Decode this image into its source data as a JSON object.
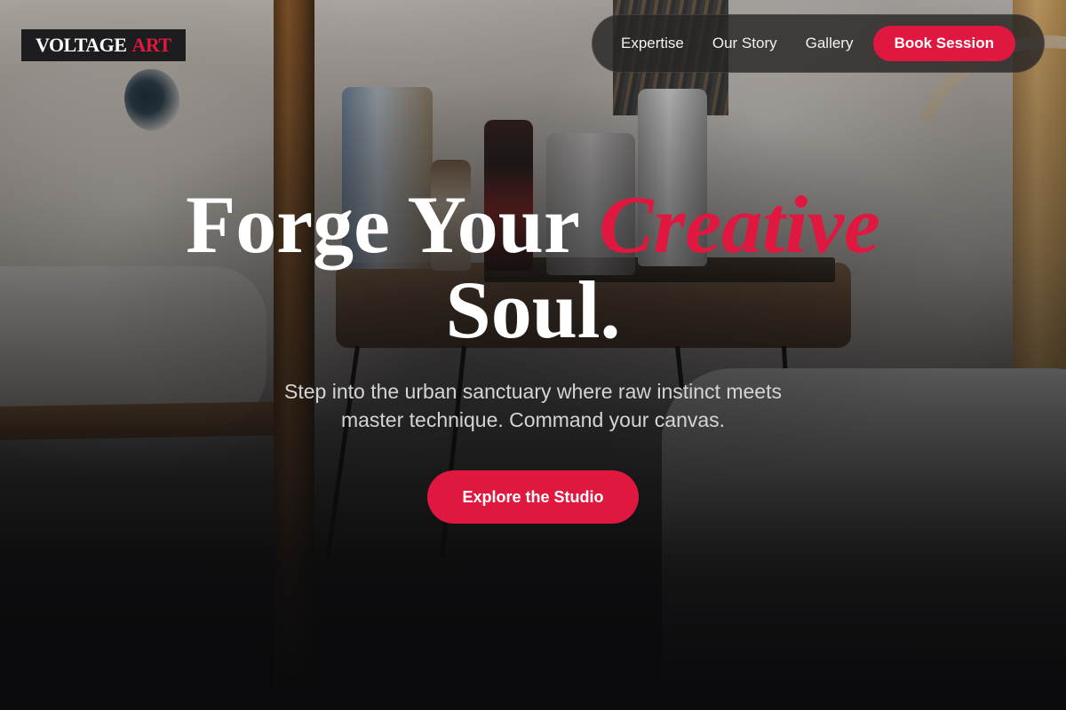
{
  "brand": {
    "word1": "VOLTAGE",
    "word2": "ART"
  },
  "nav": {
    "links": [
      "Expertise",
      "Our Story",
      "Gallery"
    ],
    "cta": "Book Session"
  },
  "hero": {
    "title_part1": "Forge Your",
    "title_accent": "Creative",
    "title_part2": "Soul.",
    "subtitle_line1": "Step into the urban sanctuary where raw instinct meets",
    "subtitle_line2": "master technique. Command your canvas.",
    "cta": "Explore the Studio"
  },
  "colors": {
    "accent": "#e0183f",
    "background": "#0b0b0c",
    "nav_bg": "#28262433"
  }
}
